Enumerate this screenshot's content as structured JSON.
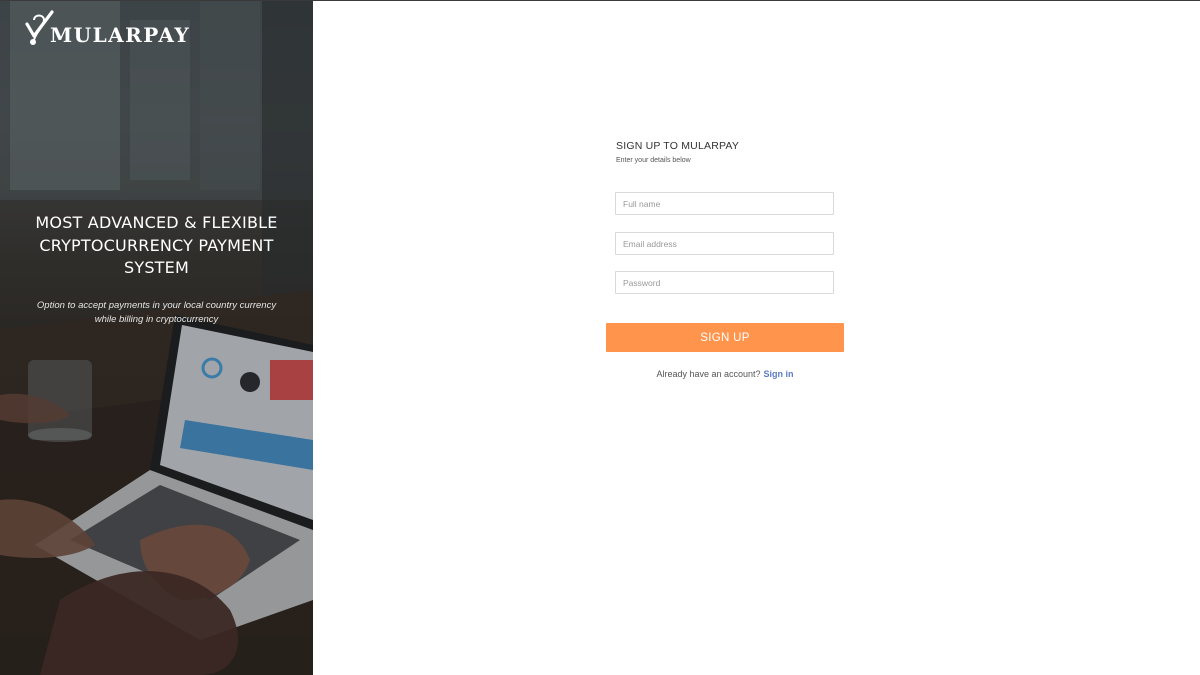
{
  "brand": {
    "logo_text": "MULARPAY",
    "icon": "checkmark-pin-icon"
  },
  "hero": {
    "headline_line1": "MOST ADVANCED & FLEXIBLE",
    "headline_line2": "CRYPTOCURRENCY PAYMENT",
    "headline_line3": "SYSTEM",
    "subtext_line1": "Option to accept payments in your local country currency",
    "subtext_line2": "while billing in cryptocurrency",
    "background": "laptop-workspace-photo"
  },
  "signup_form": {
    "title": "SIGN UP TO MULARPAY",
    "subtitle": "Enter your details below",
    "full_name_placeholder": "Full name",
    "full_name_value": "",
    "email_placeholder": "Email address",
    "email_value": "",
    "password_placeholder": "Password",
    "password_value": "",
    "submit_label": "SIGN UP",
    "have_account_text": "Already have an account?",
    "signin_link_label": "Sign in"
  },
  "colors": {
    "accent_orange": "#ff944d",
    "link_blue": "#5b7cc4",
    "hero_text": "#ffffff",
    "field_border": "#d9d9d9"
  }
}
